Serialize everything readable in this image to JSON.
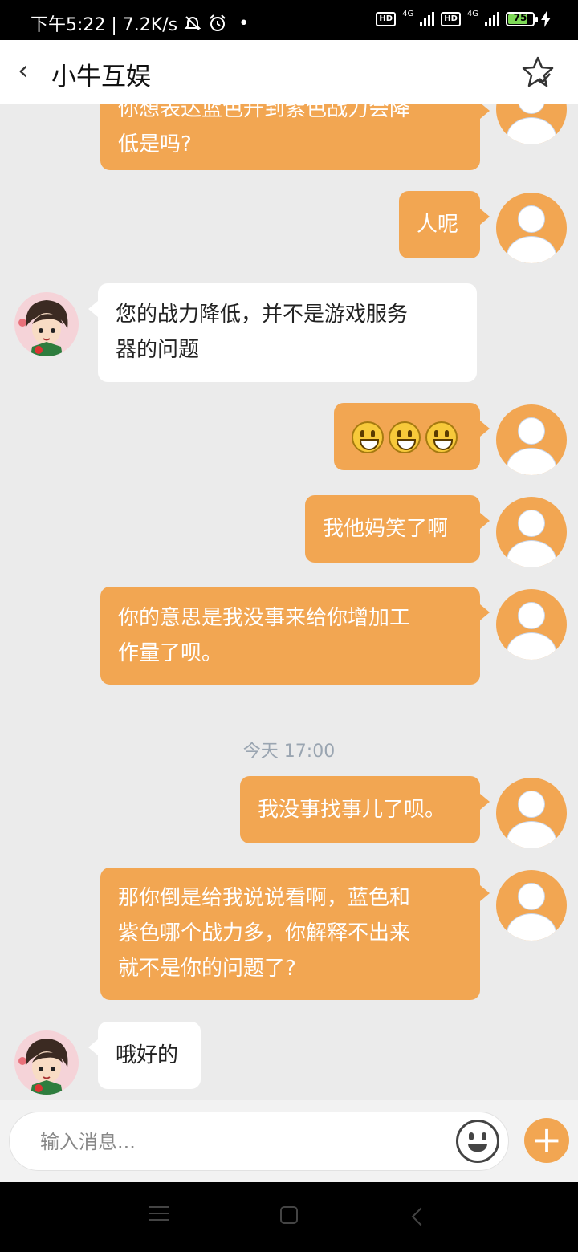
{
  "status_bar": {
    "time_speed": "下午5:22 | 7.2K/s",
    "hd1": "HD",
    "net1": "4G",
    "hd2": "HD",
    "net2": "4G",
    "battery": "75"
  },
  "header": {
    "back_icon": "‹",
    "title": "小牛互娱"
  },
  "messages": [
    {
      "side": "out",
      "lines": [
        "你想表达蓝色升到紫色战力会降",
        "低是吗?"
      ]
    },
    {
      "side": "out",
      "lines": [
        "人呢"
      ]
    },
    {
      "side": "in",
      "lines": [
        "您的战力降低，并不是游戏服务",
        "器的问题"
      ]
    },
    {
      "side": "out",
      "emoji_count": 3,
      "emoji": "smiley"
    },
    {
      "side": "out",
      "lines": [
        "我他妈笑了啊"
      ]
    },
    {
      "side": "out",
      "lines": [
        "你的意思是我没事来给你增加工",
        "作量了呗。"
      ]
    },
    {
      "side": "timestamp",
      "text": "今天 17:00"
    },
    {
      "side": "out",
      "lines": [
        "我没事找事儿了呗。"
      ]
    },
    {
      "side": "out",
      "lines": [
        "那你倒是给我说说看啊，蓝色和",
        "紫色哪个战力多，你解释不出来",
        "就不是你的问题了?"
      ]
    },
    {
      "side": "in",
      "lines": [
        "哦好的"
      ]
    }
  ],
  "input_bar": {
    "placeholder": "输入消息...",
    "plus_label": "+"
  },
  "colors": {
    "accent": "#f2a652",
    "background": "#ebebeb"
  }
}
